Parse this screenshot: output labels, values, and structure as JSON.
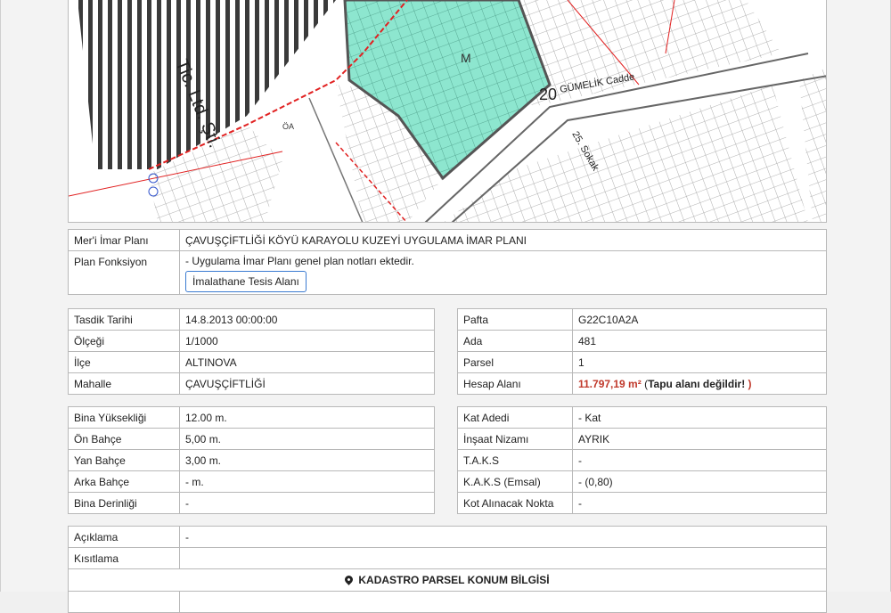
{
  "map": {
    "labels": {
      "company": "Tic. Ltd. Şti.",
      "street": "GÜMELİK Cadde",
      "street_num": "20",
      "sokak": "25. Sokak",
      "parcel_mark": "M",
      "oa": "ÖA"
    },
    "colors": {
      "parcel_fill": "#8de6cf",
      "red": "#e12121"
    }
  },
  "plan": {
    "rows": [
      {
        "key": "Mer'i İmar Planı",
        "value": "ÇAVUŞÇİFTLİĞİ KÖYÜ KARAYOLU KUZEYİ UYGULAMA İMAR PLANI"
      },
      {
        "key": "Plan Fonksiyon",
        "value": "- Uygulama İmar Planı genel plan notları ektedir.",
        "button": "İmalathane Tesis Alanı"
      }
    ]
  },
  "left1": [
    {
      "key": "Tasdik Tarihi",
      "value": "14.8.2013 00:00:00"
    },
    {
      "key": "Ölçeği",
      "value": "1/1000"
    },
    {
      "key": "İlçe",
      "value": "ALTINOVA"
    },
    {
      "key": "Mahalle",
      "value": "ÇAVUŞÇİFTLİĞİ"
    }
  ],
  "right1": [
    {
      "key": "Pafta",
      "value": "G22C10A2A"
    },
    {
      "key": "Ada",
      "value": "481"
    },
    {
      "key": "Parsel",
      "value": "1"
    },
    {
      "key": "Hesap Alanı",
      "value": "11.797,19 m²",
      "paren_open": "(",
      "note": "Tapu alanı değildir!",
      "paren_close": ")"
    }
  ],
  "left2": [
    {
      "key": "Bina Yüksekliği",
      "value": "12.00 m."
    },
    {
      "key": "Ön Bahçe",
      "value": "5,00 m."
    },
    {
      "key": "Yan Bahçe",
      "value": "3,00 m."
    },
    {
      "key": "Arka Bahçe",
      "value": "- m."
    },
    {
      "key": "Bina Derinliği",
      "value": "-"
    }
  ],
  "right2": [
    {
      "key": "Kat Adedi",
      "value": "- Kat"
    },
    {
      "key": "İnşaat Nizamı",
      "value": "AYRIK"
    },
    {
      "key": "T.A.K.S",
      "value": "-"
    },
    {
      "key": "K.A.K.S (Emsal)",
      "value": "- (0,80)"
    },
    {
      "key": "Kot Alınacak Nokta",
      "value": "-"
    }
  ],
  "bottom": [
    {
      "key": "Açıklama",
      "value": "-"
    },
    {
      "key": "Kısıtlama",
      "value": ""
    }
  ],
  "kadastro_title": "KADASTRO PARSEL KONUM BİLGİSİ",
  "icons": {
    "kadastro": "map-pin-icon"
  }
}
